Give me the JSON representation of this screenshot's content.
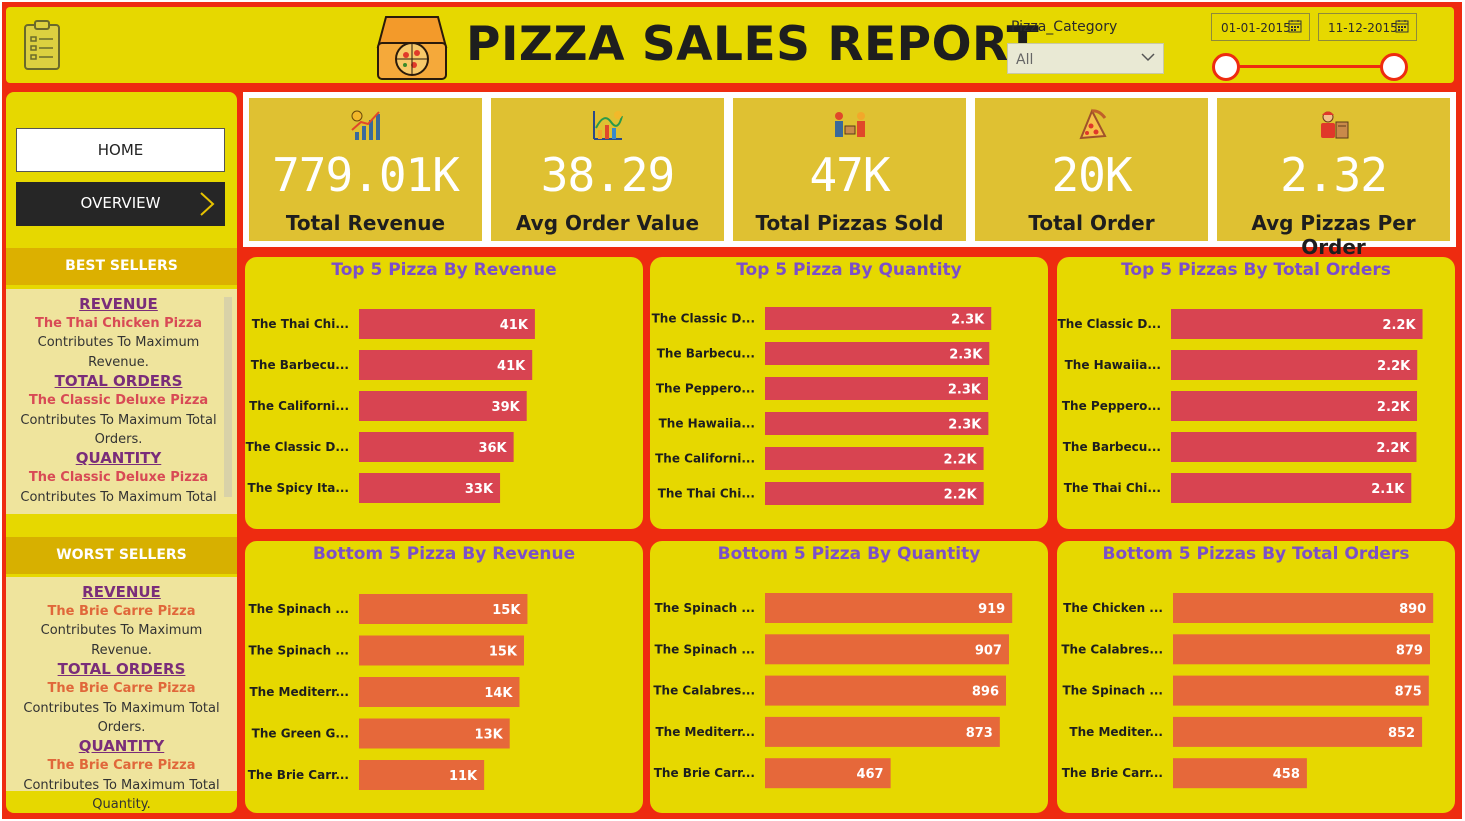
{
  "header": {
    "title": "PIZZA SALES REPORT",
    "slicer_label": "Pizza_Category",
    "slicer_value": "All",
    "date_start": "01-01-2015",
    "date_end": "11-12-2015",
    "range_start_fraction": 0.0,
    "range_end_fraction": 1.0
  },
  "nav": {
    "home": "HOME",
    "overview": "OVERVIEW"
  },
  "best": {
    "heading": "BEST SELLERS",
    "revenue_head": "REVENUE",
    "revenue_pizza": "The Thai Chicken Pizza",
    "revenue_text": "Contributes To Maximum Revenue.",
    "orders_head": "TOTAL ORDERS",
    "orders_pizza": "The Classic Deluxe Pizza",
    "orders_text": "Contributes To Maximum Total Orders.",
    "qty_head": "QUANTITY",
    "qty_pizza": "The Classic Deluxe Pizza",
    "qty_text": "Contributes To Maximum Total"
  },
  "worst": {
    "heading": "WORST SELLERS",
    "revenue_head": "REVENUE",
    "revenue_pizza": "The Brie Carre Pizza",
    "revenue_text": "Contributes To Maximum Revenue.",
    "orders_head": "TOTAL ORDERS",
    "orders_pizza": "The Brie Carre Pizza",
    "orders_text": "Contributes To Maximum Total Orders.",
    "qty_head": "QUANTITY",
    "qty_pizza": "The Brie Carre Pizza",
    "qty_text": "Contributes To Maximum Total Quantity."
  },
  "kpis": [
    {
      "value": "779.01K",
      "label": "Total Revenue",
      "icon": "revenue-growth-icon"
    },
    {
      "value": "38.29",
      "label": "Avg Order Value",
      "icon": "chart-analytics-icon"
    },
    {
      "value": "47K",
      "label": "Total Pizzas Sold",
      "icon": "delivery-icon"
    },
    {
      "value": "20K",
      "label": "Total Order",
      "icon": "pizza-slice-icon"
    },
    {
      "value": "2.32",
      "label": "Avg Pizzas Per Order",
      "icon": "delivery-person-icon"
    }
  ],
  "colors": {
    "frame": "#ee2b10",
    "panel": "#e6d800",
    "top_bar": "#d84451",
    "bottom_bar": "#e6683a",
    "title": "#7b4fc9"
  },
  "chart_data": [
    {
      "type": "bar",
      "orientation": "horizontal",
      "title": "Top 5 Pizza By Revenue",
      "categories": [
        "The Thai Chi...",
        "The Barbecu...",
        "The Californi...",
        "The Classic D...",
        "The Spicy Ita..."
      ],
      "values": [
        43434,
        42768,
        41410,
        38180,
        34831
      ],
      "labels": [
        "41K",
        "41K",
        "39K",
        "36K",
        "33K"
      ],
      "xlim": [
        0,
        80000
      ]
    },
    {
      "type": "bar",
      "orientation": "horizontal",
      "title": "Top 5 Pizza By Quantity",
      "categories": [
        "The Classic D...",
        "The Barbecu...",
        "The Peppero...",
        "The Hawaiia...",
        "The Californi...",
        "The Thai Chi..."
      ],
      "values": [
        2453,
        2432,
        2418,
        2422,
        2370,
        2371
      ],
      "labels": [
        "2.3K",
        "2.3K",
        "2.3K",
        "2.3K",
        "2.2K",
        "2.2K"
      ],
      "xlim": [
        0,
        3500
      ]
    },
    {
      "type": "bar",
      "orientation": "horizontal",
      "title": "Top 5 Pizzas By Total Orders",
      "categories": [
        "The Classic D...",
        "The Hawaiia...",
        "The Peppero...",
        "The Barbecu...",
        "The Thai Chi..."
      ],
      "values": [
        2329,
        2280,
        2278,
        2273,
        2225
      ],
      "labels": [
        "2.2K",
        "2.2K",
        "2.2K",
        "2.2K",
        "2.1K"
      ],
      "xlim": [
        0,
        3000
      ]
    },
    {
      "type": "bar",
      "orientation": "horizontal",
      "title": "Bottom 5 Pizza By Revenue",
      "categories": [
        "The Spinach ...",
        "The Spinach ...",
        "The Mediterr...",
        "The Green G...",
        "The Brie Carr..."
      ],
      "values": [
        15596,
        15277,
        14860,
        13955,
        11588
      ],
      "labels": [
        "15K",
        "15K",
        "14K",
        "13K",
        "11K"
      ],
      "xlim": [
        0,
        30000
      ]
    },
    {
      "type": "bar",
      "orientation": "horizontal",
      "title": "Bottom 5 Pizza By Quantity",
      "categories": [
        "The Spinach ...",
        "The Spinach ...",
        "The Calabres...",
        "The Mediterr...",
        "The Brie Carr..."
      ],
      "values": [
        919,
        907,
        896,
        873,
        467
      ],
      "labels": [
        "919",
        "907",
        "896",
        "873",
        "467"
      ],
      "xlim": [
        0,
        1200
      ]
    },
    {
      "type": "bar",
      "orientation": "horizontal",
      "title": "Bottom 5 Pizzas By Total Orders",
      "categories": [
        "The Chicken ...",
        "The Calabres...",
        "The Spinach ...",
        "The Mediter...",
        "The Brie Carr..."
      ],
      "values": [
        890,
        879,
        875,
        852,
        458
      ],
      "labels": [
        "890",
        "879",
        "875",
        "852",
        "458"
      ],
      "xlim": [
        0,
        1100
      ]
    }
  ]
}
